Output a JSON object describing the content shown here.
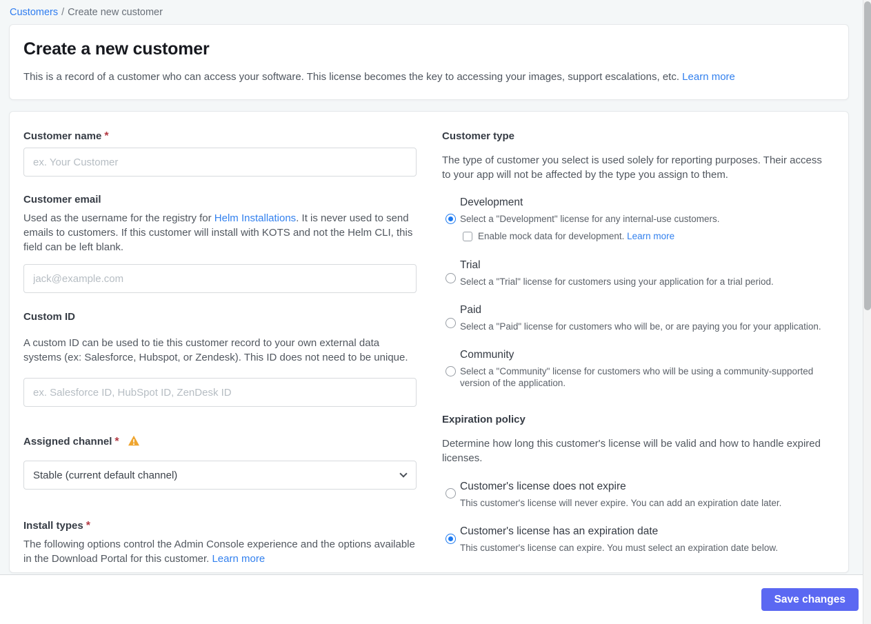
{
  "breadcrumb": {
    "link": "Customers",
    "separator": "/",
    "current": "Create new customer"
  },
  "header": {
    "title": "Create a new customer",
    "description": "This is a record of a customer who can access your software. This license becomes the key to accessing your images, support escalations, etc.",
    "learn_more": "Learn more"
  },
  "form": {
    "customer_name": {
      "label": "Customer name",
      "required_mark": "*",
      "value": "",
      "placeholder": "ex. Your Customer"
    },
    "customer_email": {
      "label": "Customer email",
      "desc_before": "Used as the username for the registry for ",
      "desc_link": "Helm Installations",
      "desc_after": ". It is never used to send emails to customers. If this customer will install with KOTS and not the Helm CLI, this field can be left blank.",
      "value": "",
      "placeholder": "jack@example.com"
    },
    "custom_id": {
      "label": "Custom ID",
      "description": "A custom ID can be used to tie this customer record to your own external data systems (ex: Salesforce, Hubspot, or Zendesk). This ID does not need to be unique.",
      "value": "",
      "placeholder": "ex. Salesforce ID, HubSpot ID, ZenDesk ID"
    },
    "assigned_channel": {
      "label": "Assigned channel",
      "required_mark": "*",
      "selected_option": "Stable (current default channel)",
      "has_warning": true
    },
    "install_types": {
      "label": "Install types",
      "required_mark": "*",
      "description": "The following options control the Admin Console experience and the options available in the Download Portal for this customer.",
      "learn_more": "Learn more"
    },
    "customer_type": {
      "label": "Customer type",
      "description": "The type of customer you select is used solely for reporting purposes. Their access to your app will not be affected by the type you assign to them.",
      "options": [
        {
          "name": "Development",
          "description": "Select a \"Development\" license for any internal-use customers.",
          "selected": true
        },
        {
          "name": "Trial",
          "description": "Select a \"Trial\" license for customers using your application for a trial period.",
          "selected": false
        },
        {
          "name": "Paid",
          "description": "Select a \"Paid\" license for customers who will be, or are paying you for your application.",
          "selected": false
        },
        {
          "name": "Community",
          "description": "Select a \"Community\" license for customers who will be using a community-supported version of the application.",
          "selected": false
        }
      ],
      "mock_data_checkbox": {
        "label": "Enable mock data for development.",
        "learn_more": "Learn more",
        "checked": false
      }
    },
    "expiration_policy": {
      "label": "Expiration policy",
      "description": "Determine how long this customer's license will be valid and how to handle expired licenses.",
      "options": [
        {
          "name": "Customer's license does not expire",
          "description": "This customer's license will never expire. You can add an expiration date later.",
          "selected": false
        },
        {
          "name": "Customer's license has an expiration date",
          "description": "This customer's license can expire. You must select an expiration date below.",
          "selected": true
        }
      ]
    }
  },
  "footer": {
    "save_label": "Save changes"
  },
  "icons": {
    "assigned_channel_warning": "warning-icon",
    "channel_select_chevron": "chevron-down-icon"
  },
  "colors": {
    "page_background": "#f4f7f8",
    "link_blue": "#3280ee",
    "breadcrumb_blue": "#2e7cf0",
    "radio_selected_blue": "#1a78f0",
    "save_button_indigo": "#5b68f2",
    "warning_amber": "#efa52f",
    "required_red": "#b23842"
  }
}
